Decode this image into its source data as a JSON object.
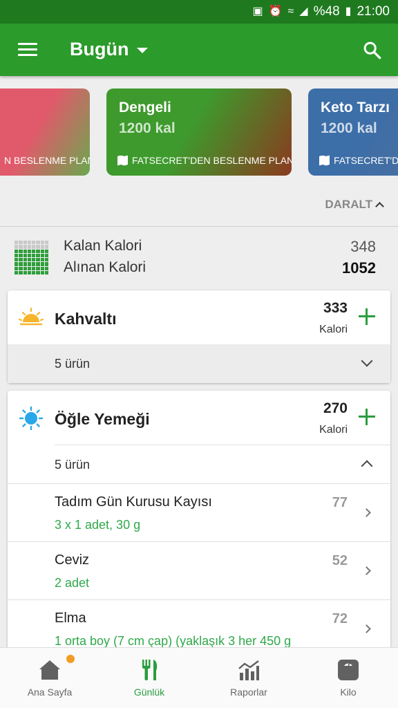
{
  "status_bar": {
    "battery": "%48",
    "time": "21:00"
  },
  "app_bar": {
    "title": "Bugün"
  },
  "plans": [
    {
      "name": "",
      "kcal": "",
      "source": "N BESLENME PLANLA",
      "gradient": [
        "#e15a6b",
        "#6aa84f"
      ]
    },
    {
      "name": "Dengeli",
      "kcal": "1200 kal",
      "source": "FATSECRET'DEN BESLENME PLANLA",
      "gradient": [
        "#3e9a2d",
        "#8b3a1f"
      ]
    },
    {
      "name": "Keto Tarzı",
      "kcal": "1200 kal",
      "source": "FATSECRET'DE",
      "gradient": [
        "#3c6ea8",
        "#466fa0"
      ]
    }
  ],
  "collapse": {
    "label": "DARALT"
  },
  "summary": {
    "remaining_label": "Kalan Kalori",
    "remaining_value": "348",
    "consumed_label": "Alınan Kalori",
    "consumed_value": "1052",
    "consumed_fraction": 0.75
  },
  "meals": [
    {
      "name": "Kahvaltı",
      "calories": "333",
      "unit": "Kalori",
      "count": "5 ürün",
      "expanded": false,
      "icon": "sunrise-icon"
    },
    {
      "name": "Öğle Yemeği",
      "calories": "270",
      "unit": "Kalori",
      "count": "5 ürün",
      "expanded": true,
      "icon": "sun-icon",
      "items": [
        {
          "name": "Tadım Gün Kurusu Kayısı",
          "portion": "3  x 1 adet, 30 g",
          "calories": "77"
        },
        {
          "name": "Ceviz",
          "portion": "2 adet",
          "calories": "52"
        },
        {
          "name": "Elma",
          "portion": "1 orta boy (7 cm çap) (yaklaşık 3 her 450 g",
          "calories": "72"
        }
      ]
    }
  ],
  "bottom_nav": [
    {
      "label": "Ana Sayfa",
      "icon": "home-icon",
      "active": false,
      "badge": true
    },
    {
      "label": "Günlük",
      "icon": "cutlery-icon",
      "active": true,
      "badge": false
    },
    {
      "label": "Raporlar",
      "icon": "chart-icon",
      "active": false,
      "badge": false
    },
    {
      "label": "Kilo",
      "icon": "scale-icon",
      "active": false,
      "badge": false
    }
  ],
  "colors": {
    "primary": "#2b9b2b",
    "primary_dark": "#1f7a1f",
    "accent_green": "#2a9d3f",
    "badge_orange": "#f39c22"
  }
}
